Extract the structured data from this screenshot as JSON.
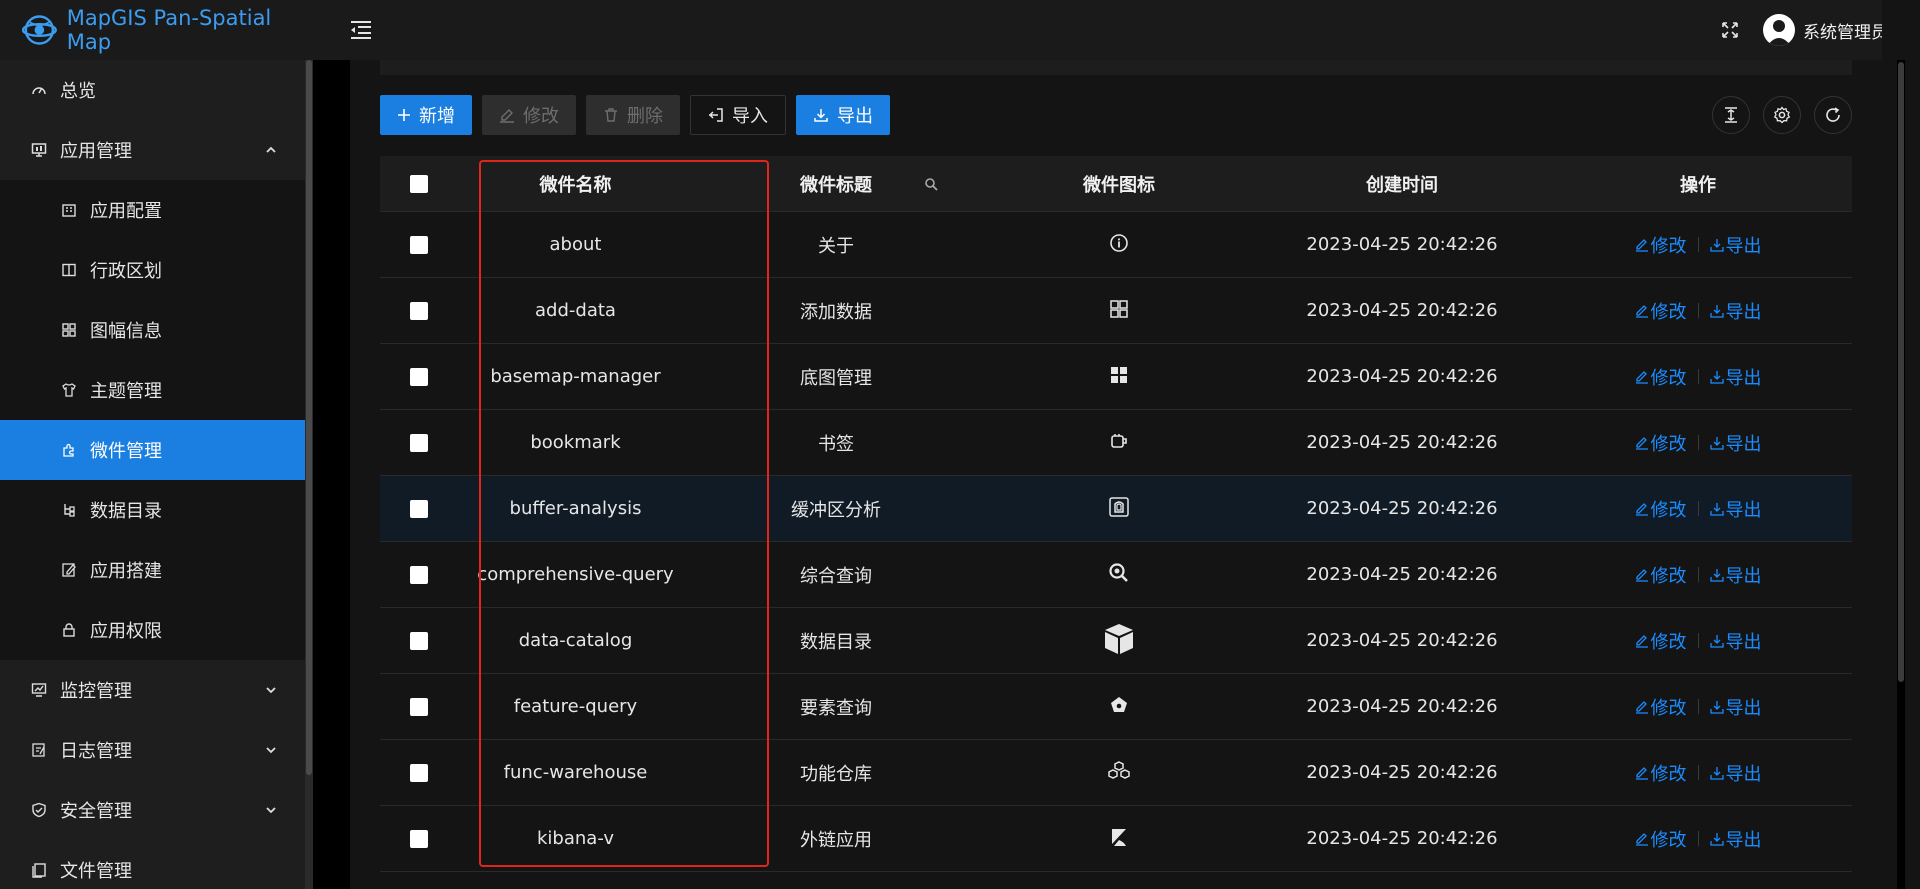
{
  "header": {
    "app_title": "MapGIS Pan-Spatial Map",
    "user_name": "系统管理员"
  },
  "sidebar": {
    "items": [
      {
        "label": "总览",
        "icon": "dashboard-icon",
        "level": "top"
      },
      {
        "label": "应用管理",
        "icon": "monitor-icon",
        "level": "top",
        "expanded": true
      },
      {
        "label": "应用配置",
        "icon": "building-icon",
        "level": "sub"
      },
      {
        "label": "行政区划",
        "icon": "columns-icon",
        "level": "sub"
      },
      {
        "label": "图幅信息",
        "icon": "grid-icon",
        "level": "sub"
      },
      {
        "label": "主题管理",
        "icon": "shirt-icon",
        "level": "sub"
      },
      {
        "label": "微件管理",
        "icon": "plugin-icon",
        "level": "sub",
        "active": true
      },
      {
        "label": "数据目录",
        "icon": "tree-icon",
        "level": "sub"
      },
      {
        "label": "应用搭建",
        "icon": "edit-icon",
        "level": "sub"
      },
      {
        "label": "应用权限",
        "icon": "lock-icon",
        "level": "sub"
      },
      {
        "label": "监控管理",
        "icon": "fund-icon",
        "level": "top",
        "expanded": false
      },
      {
        "label": "日志管理",
        "icon": "log-icon",
        "level": "top",
        "expanded": false
      },
      {
        "label": "安全管理",
        "icon": "shield-icon",
        "level": "top",
        "expanded": false
      },
      {
        "label": "文件管理",
        "icon": "file-icon",
        "level": "top"
      }
    ]
  },
  "toolbar": {
    "add_label": "新增",
    "edit_label": "修改",
    "delete_label": "删除",
    "import_label": "导入",
    "export_label": "导出"
  },
  "table": {
    "columns": [
      "微件名称",
      "微件标题",
      "微件图标",
      "创建时间",
      "操作"
    ],
    "ops": {
      "edit": "修改",
      "export": "导出"
    },
    "rows": [
      {
        "name": "about",
        "title": "关于",
        "icon": "info-circle-icon",
        "time": "2023-04-25 20:42:26"
      },
      {
        "name": "add-data",
        "title": "添加数据",
        "icon": "appstore-outline-icon",
        "time": "2023-04-25 20:42:26"
      },
      {
        "name": "basemap-manager",
        "title": "底图管理",
        "icon": "appstore-filled-icon",
        "time": "2023-04-25 20:42:26"
      },
      {
        "name": "bookmark",
        "title": "书签",
        "icon": "bookmark-icon",
        "time": "2023-04-25 20:42:26"
      },
      {
        "name": "buffer-analysis",
        "title": "缓冲区分析",
        "icon": "buffer-icon",
        "time": "2023-04-25 20:42:26"
      },
      {
        "name": "comprehensive-query",
        "title": "综合查询",
        "icon": "zoom-search-icon",
        "time": "2023-04-25 20:42:26"
      },
      {
        "name": "data-catalog",
        "title": "数据目录",
        "icon": "cube-icon",
        "time": "2023-04-25 20:42:26"
      },
      {
        "name": "feature-query",
        "title": "要素查询",
        "icon": "pentagon-icon",
        "time": "2023-04-25 20:42:26"
      },
      {
        "name": "func-warehouse",
        "title": "功能仓库",
        "icon": "cubes-icon",
        "time": "2023-04-25 20:42:26"
      },
      {
        "name": "kibana-v",
        "title": "外链应用",
        "icon": "kibana-icon",
        "time": "2023-04-25 20:42:26"
      }
    ]
  },
  "colors": {
    "accent": "#1a7fe0",
    "link": "#1a8cff",
    "highlight_border": "#e0261a"
  }
}
